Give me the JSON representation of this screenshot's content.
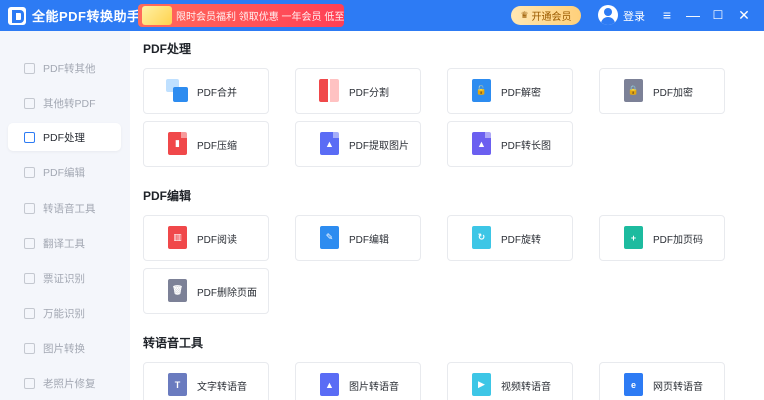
{
  "app": {
    "title": "全能PDF转换助手"
  },
  "header": {
    "promo_text": "限时会员福利 领取优惠 一年会员 低至",
    "vip_label": "开通会员",
    "login_label": "登录",
    "controls": {
      "menu": "≡",
      "minimize": "—",
      "maximize": "☐",
      "close": "✕"
    }
  },
  "sidebar": {
    "items": [
      {
        "label": "PDF转其他"
      },
      {
        "label": "其他转PDF"
      },
      {
        "label": "PDF处理"
      },
      {
        "label": "PDF编辑"
      },
      {
        "label": "转语音工具"
      },
      {
        "label": "翻译工具"
      },
      {
        "label": "票证识别"
      },
      {
        "label": "万能识别"
      },
      {
        "label": "图片转换"
      },
      {
        "label": "老照片修复"
      }
    ]
  },
  "sections": [
    {
      "title": "PDF处理",
      "cards": [
        {
          "label": "PDF合并",
          "icon": "merge-icon",
          "color": "#2d8cf0"
        },
        {
          "label": "PDF分割",
          "icon": "split-icon",
          "color": "#f0484a"
        },
        {
          "label": "PDF解密",
          "icon": "unlock-icon",
          "color": "#2d8cf0"
        },
        {
          "label": "PDF加密",
          "icon": "lock-icon",
          "color": "#7c8197"
        },
        {
          "label": "PDF压缩",
          "icon": "compress-icon",
          "color": "#f0484a"
        },
        {
          "label": "PDF提取图片",
          "icon": "extract-image-icon",
          "color": "#5a6cf5"
        },
        {
          "label": "PDF转长图",
          "icon": "long-image-icon",
          "color": "#6b5ff0"
        }
      ]
    },
    {
      "title": "PDF编辑",
      "cards": [
        {
          "label": "PDF阅读",
          "icon": "read-icon",
          "color": "#f0484a"
        },
        {
          "label": "PDF编辑",
          "icon": "edit-icon",
          "color": "#2d8cf0"
        },
        {
          "label": "PDF旋转",
          "icon": "rotate-icon",
          "color": "#3dc6e6"
        },
        {
          "label": "PDF加页码",
          "icon": "page-number-icon",
          "color": "#1dbb9f"
        },
        {
          "label": "PDF删除页面",
          "icon": "delete-page-icon",
          "color": "#7c8197"
        }
      ]
    },
    {
      "title": "转语音工具",
      "cards": [
        {
          "label": "文字转语音",
          "icon": "text-to-speech-icon",
          "color": "#6a7bbf"
        },
        {
          "label": "图片转语音",
          "icon": "image-to-speech-icon",
          "color": "#5a6cf5"
        },
        {
          "label": "视频转语音",
          "icon": "video-to-speech-icon",
          "color": "#3dc6e6"
        },
        {
          "label": "网页转语音",
          "icon": "web-to-speech-icon",
          "color": "#2d7bf4"
        }
      ]
    }
  ]
}
